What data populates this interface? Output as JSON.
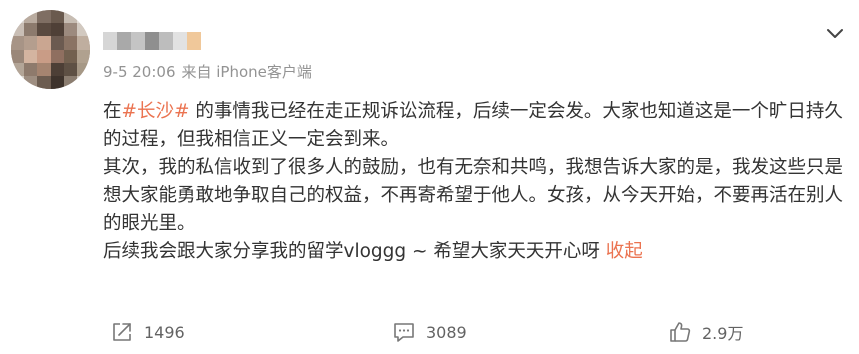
{
  "post": {
    "meta": {
      "date": "9-5 20:06",
      "source": "来自 iPhone客户端"
    },
    "content": {
      "p1_before": "在",
      "hashtag": "#长沙#",
      "p1_after": " 的事情我已经在走正规诉讼流程，后续一定会发。大家也知道这是一个旷日持久的过程，但我相信正义一定会到来。",
      "p2": "其次，我的私信收到了很多人的鼓励，也有无奈和共鸣，我想告诉大家的是，我发这些只是想大家能勇敢地争取自己的权益，不再寄希望于他人。女孩，从今天开始，不要再活在别人的眼光里。",
      "p3": "后续我会跟大家分享我的留学vloggg ~ 希望大家天天开心呀 ",
      "collapse_label": "收起"
    },
    "actions": {
      "repost_count": "1496",
      "comment_count": "3089",
      "like_count": "2.9万"
    },
    "icons": {
      "expand": "chevron-down-icon",
      "repost": "share-icon",
      "comment": "comment-icon",
      "like": "thumbs-up-icon"
    },
    "colors": {
      "accent": "#eb7350",
      "text": "#333333",
      "meta": "#939393"
    }
  }
}
